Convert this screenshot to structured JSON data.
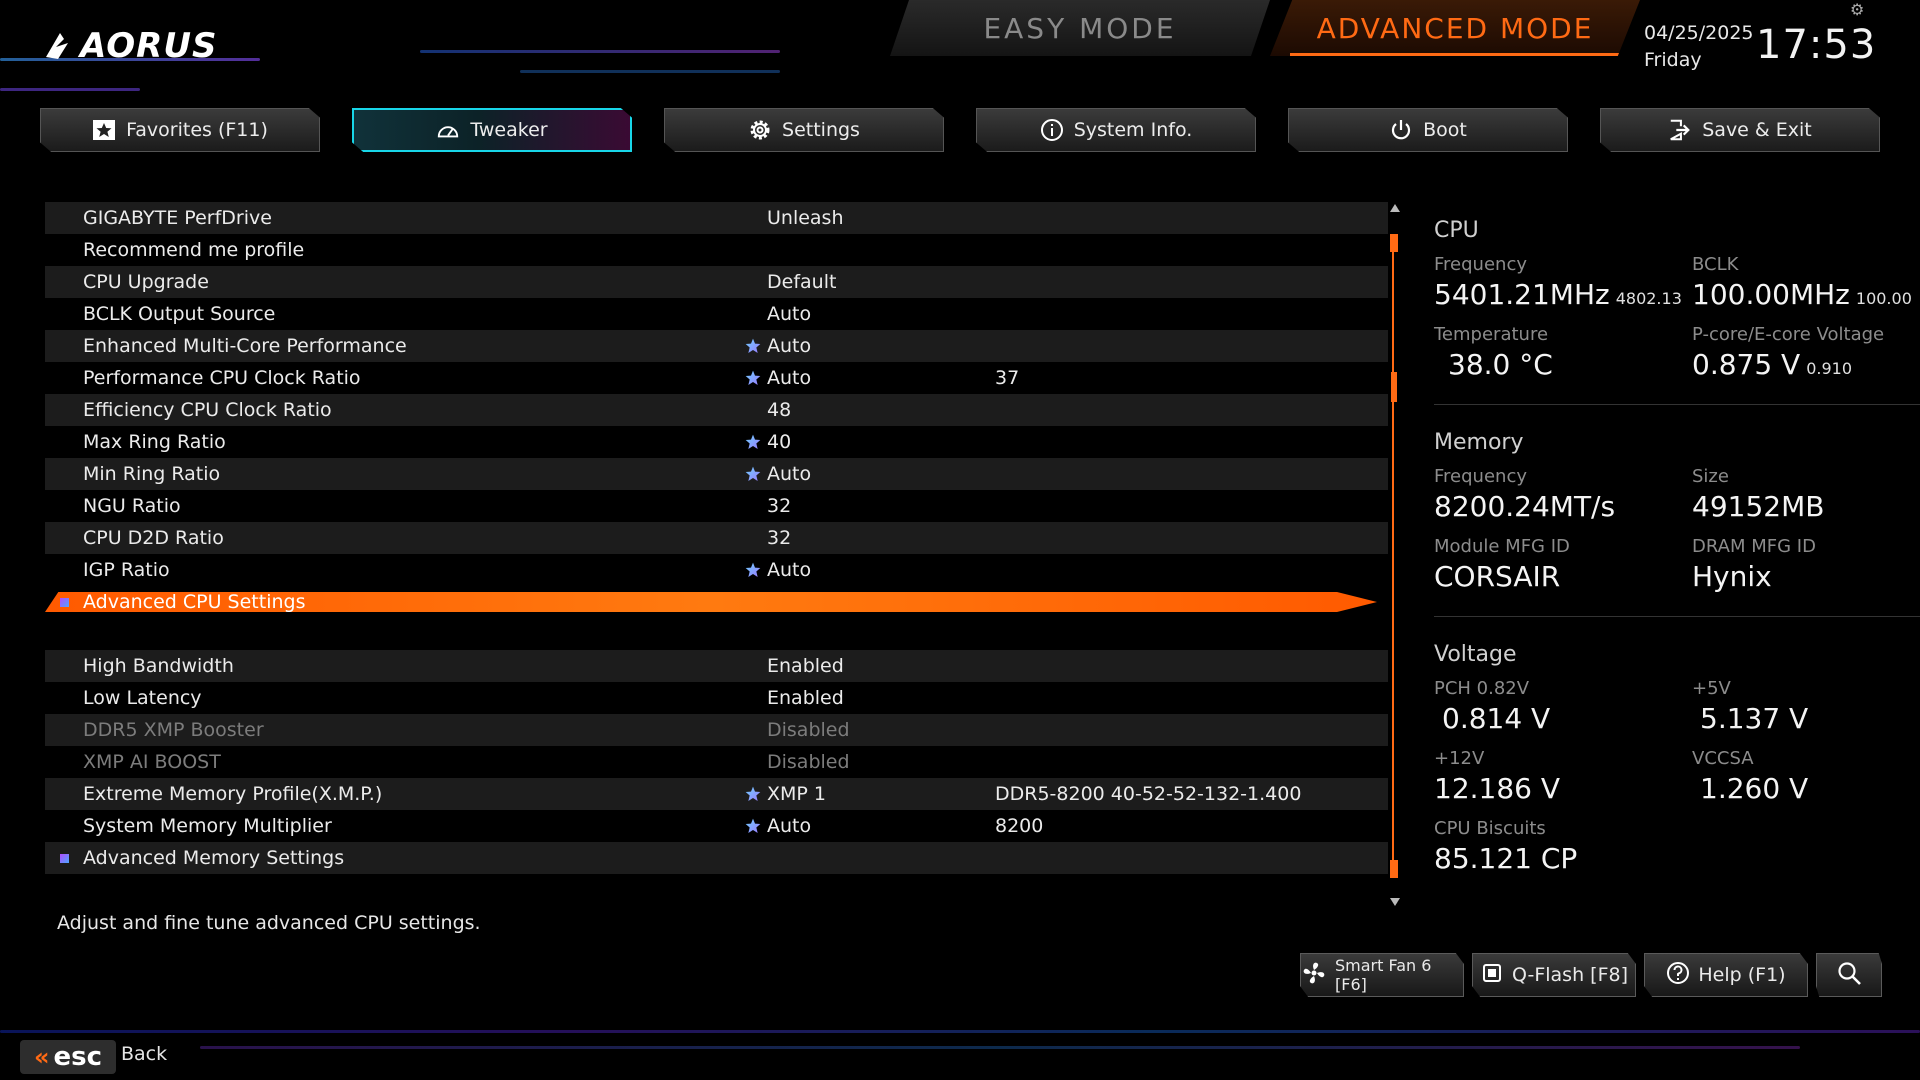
{
  "header": {
    "logo_text": "AORUS",
    "easy_mode_label": "EASY MODE",
    "advanced_mode_label": "ADVANCED MODE",
    "date": "04/25/2025",
    "weekday": "Friday",
    "time": "17:53"
  },
  "tabs": [
    {
      "label": "Favorites (F11)",
      "icon": "star-icon"
    },
    {
      "label": "Tweaker",
      "icon": "gauge-icon",
      "active": true
    },
    {
      "label": "Settings",
      "icon": "gear-icon"
    },
    {
      "label": "System Info.",
      "icon": "info-icon"
    },
    {
      "label": "Boot",
      "icon": "power-icon"
    },
    {
      "label": "Save & Exit",
      "icon": "exit-icon"
    }
  ],
  "settings": [
    {
      "name": "GIGABYTE PerfDrive",
      "value": "Unleash"
    },
    {
      "name": "Recommend me profile",
      "value": ""
    },
    {
      "name": "CPU Upgrade",
      "value": "Default"
    },
    {
      "name": "BCLK Output Source",
      "value": "Auto"
    },
    {
      "name": "Enhanced Multi-Core Performance",
      "value": "Auto",
      "star": true
    },
    {
      "name": "Performance CPU Clock Ratio",
      "value": "Auto",
      "star": true,
      "extra": "37"
    },
    {
      "name": "Efficiency CPU Clock Ratio",
      "value": "48"
    },
    {
      "name": "Max Ring Ratio",
      "value": "40",
      "star": true
    },
    {
      "name": "Min Ring Ratio",
      "value": "Auto",
      "star": true
    },
    {
      "name": "NGU Ratio",
      "value": "32"
    },
    {
      "name": "CPU D2D Ratio",
      "value": "32"
    },
    {
      "name": "IGP Ratio",
      "value": "Auto",
      "star": true
    },
    {
      "name": "Advanced CPU Settings",
      "value": "",
      "submenu": true,
      "selected": true
    },
    {
      "name": "",
      "value": ""
    },
    {
      "name": "High Bandwidth",
      "value": "Enabled"
    },
    {
      "name": "Low Latency",
      "value": "Enabled"
    },
    {
      "name": "DDR5 XMP Booster",
      "value": "Disabled",
      "dim": true
    },
    {
      "name": "XMP AI BOOST",
      "value": "Disabled",
      "dim": true
    },
    {
      "name": "Extreme Memory Profile(X.M.P.)",
      "value": "XMP 1",
      "star": true,
      "extra": "DDR5-8200 40-52-52-132-1.400"
    },
    {
      "name": "System Memory Multiplier",
      "value": "Auto",
      "star": true,
      "extra": "8200"
    },
    {
      "name": "Advanced Memory Settings",
      "value": "",
      "submenu": true
    },
    {
      "name": "",
      "value": ""
    }
  ],
  "help_text": "Adjust and fine tune advanced CPU settings.",
  "info": {
    "cpu": {
      "title": "CPU",
      "freq_label": "Frequency",
      "freq_value": "5401.21MHz",
      "freq_sub": "4802.13",
      "bclk_label": "BCLK",
      "bclk_value": "100.00MHz",
      "bclk_sub": "100.00",
      "temp_label": "Temperature",
      "temp_value": "38.0 °C",
      "volt_label": "P-core/E-core Voltage",
      "volt_value": "0.875 V",
      "volt_sub": "0.910"
    },
    "memory": {
      "title": "Memory",
      "freq_label": "Frequency",
      "freq_value": "8200.24MT/s",
      "size_label": "Size",
      "size_value": "49152MB",
      "module_label": "Module MFG ID",
      "module_value": "CORSAIR",
      "dram_label": "DRAM MFG ID",
      "dram_value": "Hynix"
    },
    "voltage": {
      "title": "Voltage",
      "pch_label": "PCH 0.82V",
      "pch_value": "0.814 V",
      "v5_label": "+5V",
      "v5_value": "5.137 V",
      "v12_label": "+12V",
      "v12_value": "12.186 V",
      "vccsa_label": "VCCSA",
      "vccsa_value": "1.260 V",
      "biscuits_label": "CPU Biscuits",
      "biscuits_value": "85.121 CP"
    }
  },
  "bottom_buttons": {
    "smartfan": "Smart Fan 6 [F6]",
    "qflash": "Q-Flash [F8]",
    "help": "Help (F1)"
  },
  "footer": {
    "esc_label": "esc",
    "back_label": "Back"
  },
  "colors": {
    "accent_orange": "#ff6a14",
    "active_tab_border": "#18d6e8",
    "star_blue": "#7fc4ff"
  }
}
